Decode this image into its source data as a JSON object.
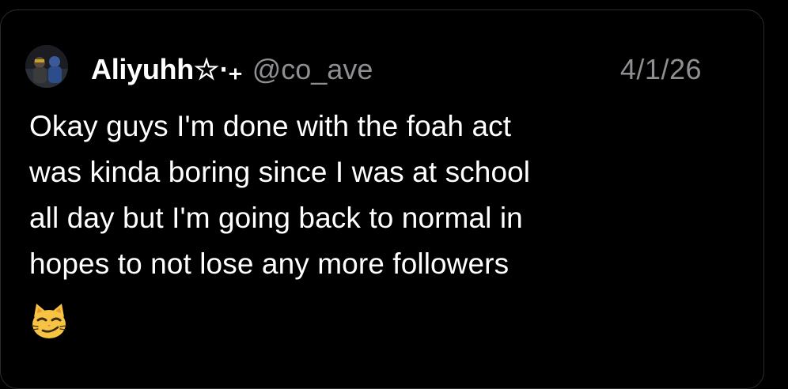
{
  "post": {
    "author": {
      "display_name": "Aliyuhh☆⋅₊",
      "handle": "@co_ave"
    },
    "date": "4/1/26",
    "text_lines": [
      "Okay guys I'm done with the foah act",
      "was kinda boring since I was at school",
      "all day but I'm going back to normal in",
      "hopes to not lose any more followers"
    ],
    "emoji": "smirking-cat-face-icon"
  },
  "colors": {
    "background": "#000000",
    "card_border": "#2c2c2e",
    "primary_text": "#ffffff",
    "secondary_text": "#8e8e93",
    "emoji_fill": "#f6c343"
  }
}
